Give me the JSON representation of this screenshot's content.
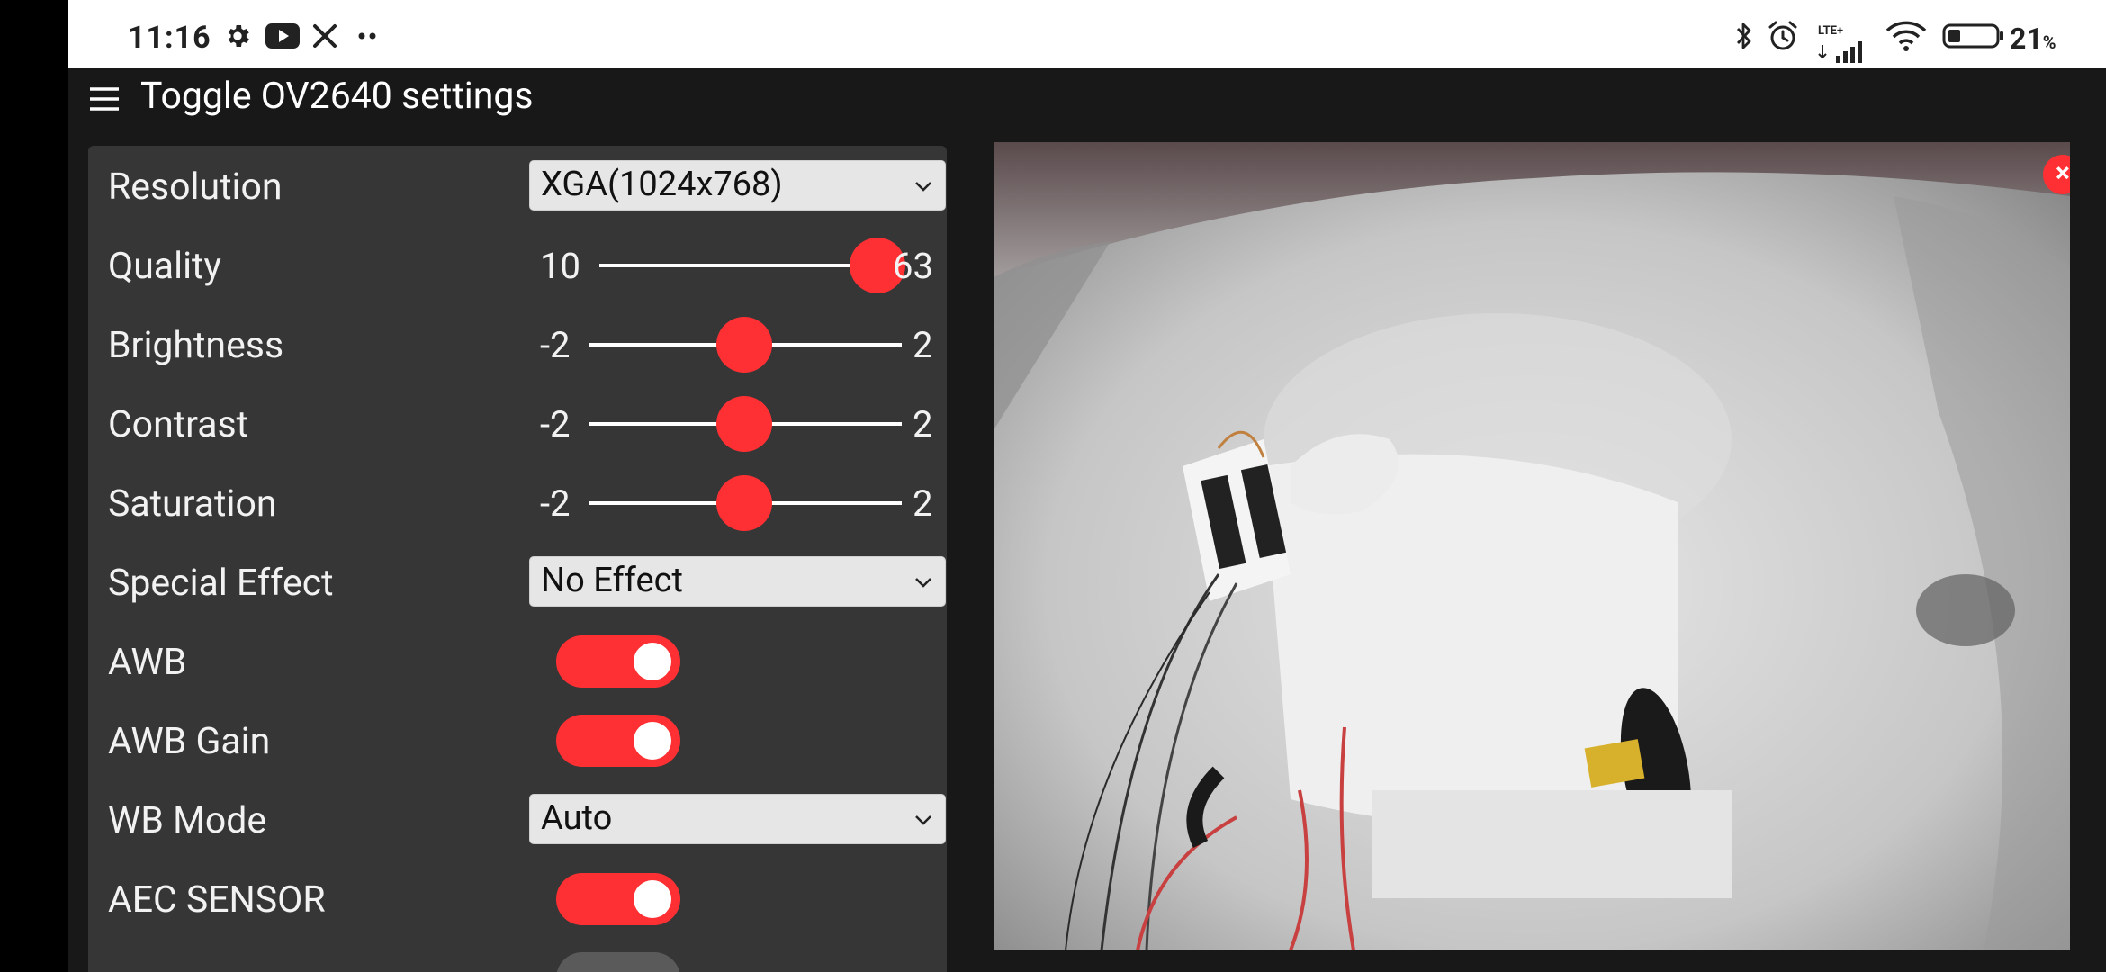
{
  "status_bar": {
    "time": "11:16",
    "left_icons": [
      "gear-icon",
      "youtube-icon",
      "x-icon",
      "more-dots-icon"
    ],
    "right_icons": [
      "bluetooth-icon",
      "alarm-icon",
      "signal-icon",
      "wifi-icon",
      "battery-icon"
    ],
    "network_label": "LTE+",
    "battery_percent": "21",
    "battery_unit": "%"
  },
  "header": {
    "menu_icon": "hamburger-icon",
    "title": "Toggle OV2640 settings"
  },
  "settings": {
    "resolution": {
      "label": "Resolution",
      "value": "XGA(1024x768)"
    },
    "quality": {
      "label": "Quality",
      "min": "10",
      "max": "63",
      "value": 63
    },
    "brightness": {
      "label": "Brightness",
      "min": "-2",
      "max": "2",
      "value": 0
    },
    "contrast": {
      "label": "Contrast",
      "min": "-2",
      "max": "2",
      "value": 0
    },
    "saturation": {
      "label": "Saturation",
      "min": "-2",
      "max": "2",
      "value": 0
    },
    "special_effect": {
      "label": "Special Effect",
      "value": "No Effect"
    },
    "awb": {
      "label": "AWB",
      "on": true
    },
    "awb_gain": {
      "label": "AWB Gain",
      "on": true
    },
    "wb_mode": {
      "label": "WB Mode",
      "value": "Auto"
    },
    "aec_sensor": {
      "label": "AEC SENSOR",
      "on": true
    }
  },
  "stream": {
    "close_label": "×"
  },
  "colors": {
    "accent": "#ff3034",
    "panel": "#363636",
    "background": "#181818"
  }
}
